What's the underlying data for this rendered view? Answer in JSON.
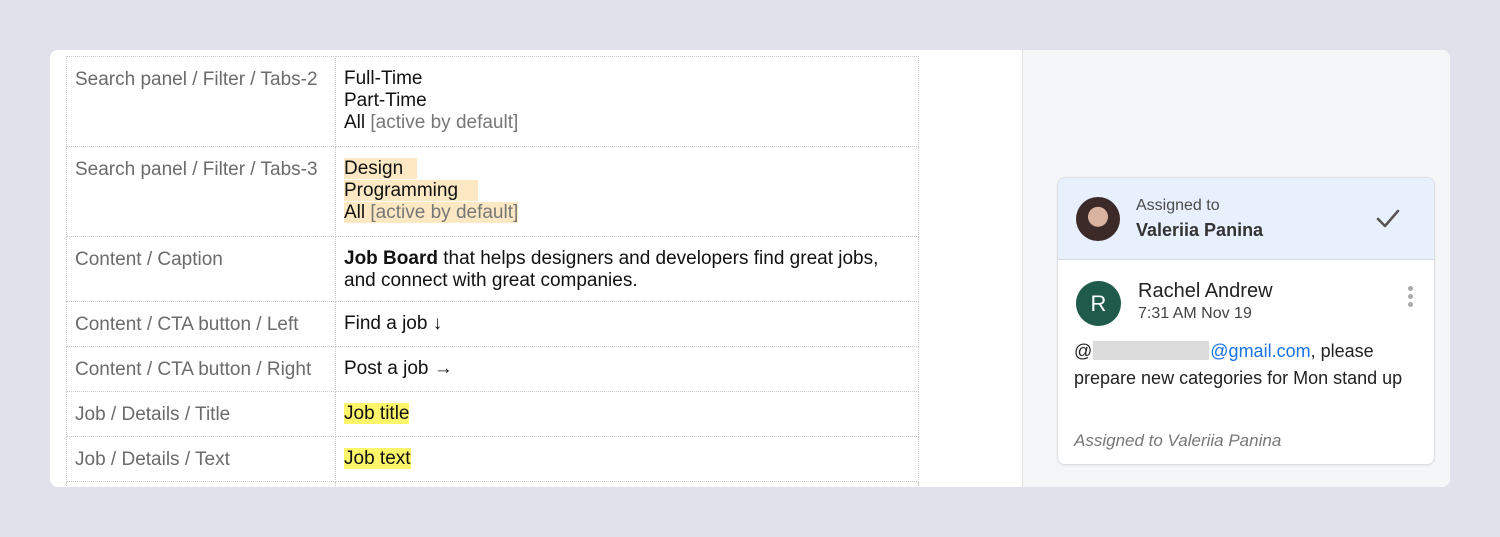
{
  "table": {
    "rows": [
      {
        "key": "Search panel / Filter / Tabs-2",
        "lines": [
          {
            "text": "Full-Time",
            "note": ""
          },
          {
            "text": "Part-Time",
            "note": ""
          },
          {
            "text": "All",
            "note": " [active by default]"
          }
        ]
      },
      {
        "key": "Search panel / Filter / Tabs-3",
        "lines": [
          {
            "text": "Design",
            "note": ""
          },
          {
            "text": "Programming",
            "note": ""
          },
          {
            "text": "All",
            "note": " [active by default]"
          }
        ]
      },
      {
        "key": "Content / Caption",
        "bold": "Job Board",
        "rest": " that helps designers and developers find great jobs, and connect with great companies."
      },
      {
        "key": "Content / CTA button / Left",
        "value": "Find a job ↓"
      },
      {
        "key": "Content / CTA button / Right",
        "value": "Post a job →"
      },
      {
        "key": "Job / Details / Title",
        "value": "Job title"
      },
      {
        "key": "Job / Details / Text",
        "value": "Job text"
      }
    ]
  },
  "comment": {
    "assigned_label": "Assigned to",
    "assignee": "Valeriia Panina",
    "author_initial": "R",
    "author": "Rachel Andrew",
    "time": "7:31 AM Nov 19",
    "at_sign": "@",
    "email_domain": "@gmail.com",
    "message": ", please prepare new categories for Mon stand up",
    "footnote": "Assigned to Valeriia Panina"
  },
  "colors": {
    "highlight_orange": "#fce8c3",
    "highlight_yellow": "#fdf56a",
    "link": "#1a73e8",
    "avatar_r": "#1f5a4a",
    "card_header": "#e8effd"
  },
  "icons": [
    "check-icon",
    "more-vert-icon"
  ]
}
